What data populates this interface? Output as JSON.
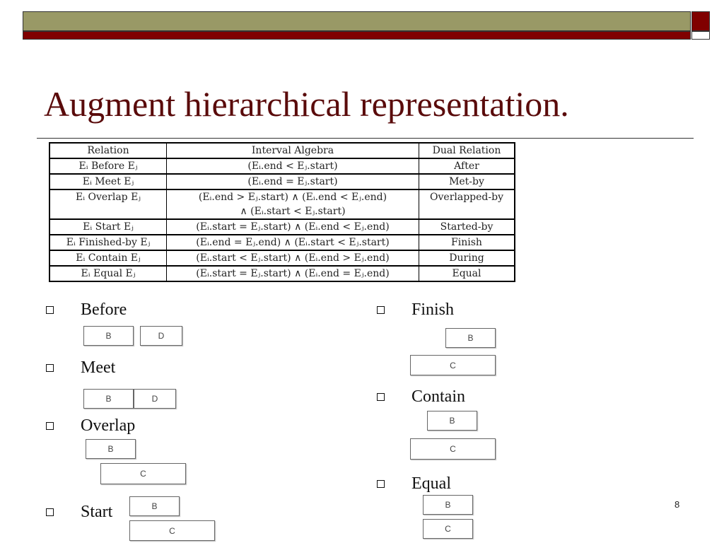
{
  "title": "Augment hierarchical representation.",
  "table": {
    "headers": [
      "Relation",
      "Interval Algebra",
      "Dual Relation"
    ],
    "rows": [
      {
        "relation": "Eᵢ Before Eⱼ",
        "algebra": "(Eᵢ.end < Eⱼ.start)",
        "dual": "After"
      },
      {
        "relation": "Eᵢ Meet Eⱼ",
        "algebra": "(Eᵢ.end = Eⱼ.start)",
        "dual": "Met-by"
      },
      {
        "relation": "Eᵢ Overlap Eⱼ",
        "algebra": "(Eᵢ.end > Eⱼ.start) ∧ (Eᵢ.end < Eⱼ.end)",
        "algebra2": "∧ (Eᵢ.start < Eⱼ.start)",
        "dual": "Overlapped-by"
      },
      {
        "relation": "Eᵢ Start Eⱼ",
        "algebra": "(Eᵢ.start = Eⱼ.start) ∧ (Eᵢ.end < Eⱼ.end)",
        "dual": "Started-by"
      },
      {
        "relation": "Eᵢ Finished-by Eⱼ",
        "algebra": "(Eᵢ.end = Eⱼ.end) ∧ (Eᵢ.start < Eⱼ.start)",
        "dual": "Finish"
      },
      {
        "relation": "Eᵢ Contain Eⱼ",
        "algebra": "(Eᵢ.start < Eⱼ.start) ∧ (Eᵢ.end > Eⱼ.end)",
        "dual": "During"
      },
      {
        "relation": "Eᵢ Equal Eⱼ",
        "algebra": "(Eᵢ.start = Eⱼ.start) ∧ (Eᵢ.end = Eⱼ.end)",
        "dual": "Equal"
      }
    ]
  },
  "bullets": {
    "before": "Before",
    "meet": "Meet",
    "overlap": "Overlap",
    "start": "Start",
    "finish": "Finish",
    "contain": "Contain",
    "equal": "Equal"
  },
  "boxes": {
    "b": "B",
    "c": "C",
    "d": "D"
  },
  "page_number": "8"
}
